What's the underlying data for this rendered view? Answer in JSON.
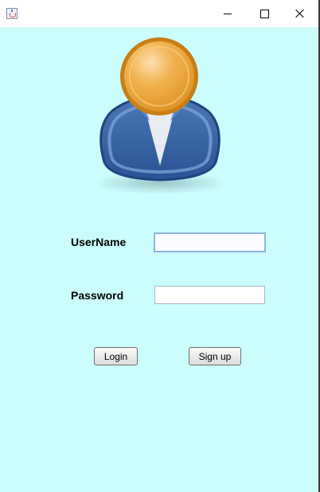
{
  "window": {
    "icon": "java-cup-icon",
    "controls": {
      "minimize": "minimize-icon",
      "maximize": "maximize-icon",
      "close": "close-icon"
    },
    "background_color": "#cbfdfd"
  },
  "avatar": {
    "icon": "user-avatar-icon"
  },
  "form": {
    "username_label": "UserName",
    "username_value": "",
    "password_label": "Password",
    "password_value": ""
  },
  "buttons": {
    "login_label": "Login",
    "signup_label": "Sign up"
  }
}
